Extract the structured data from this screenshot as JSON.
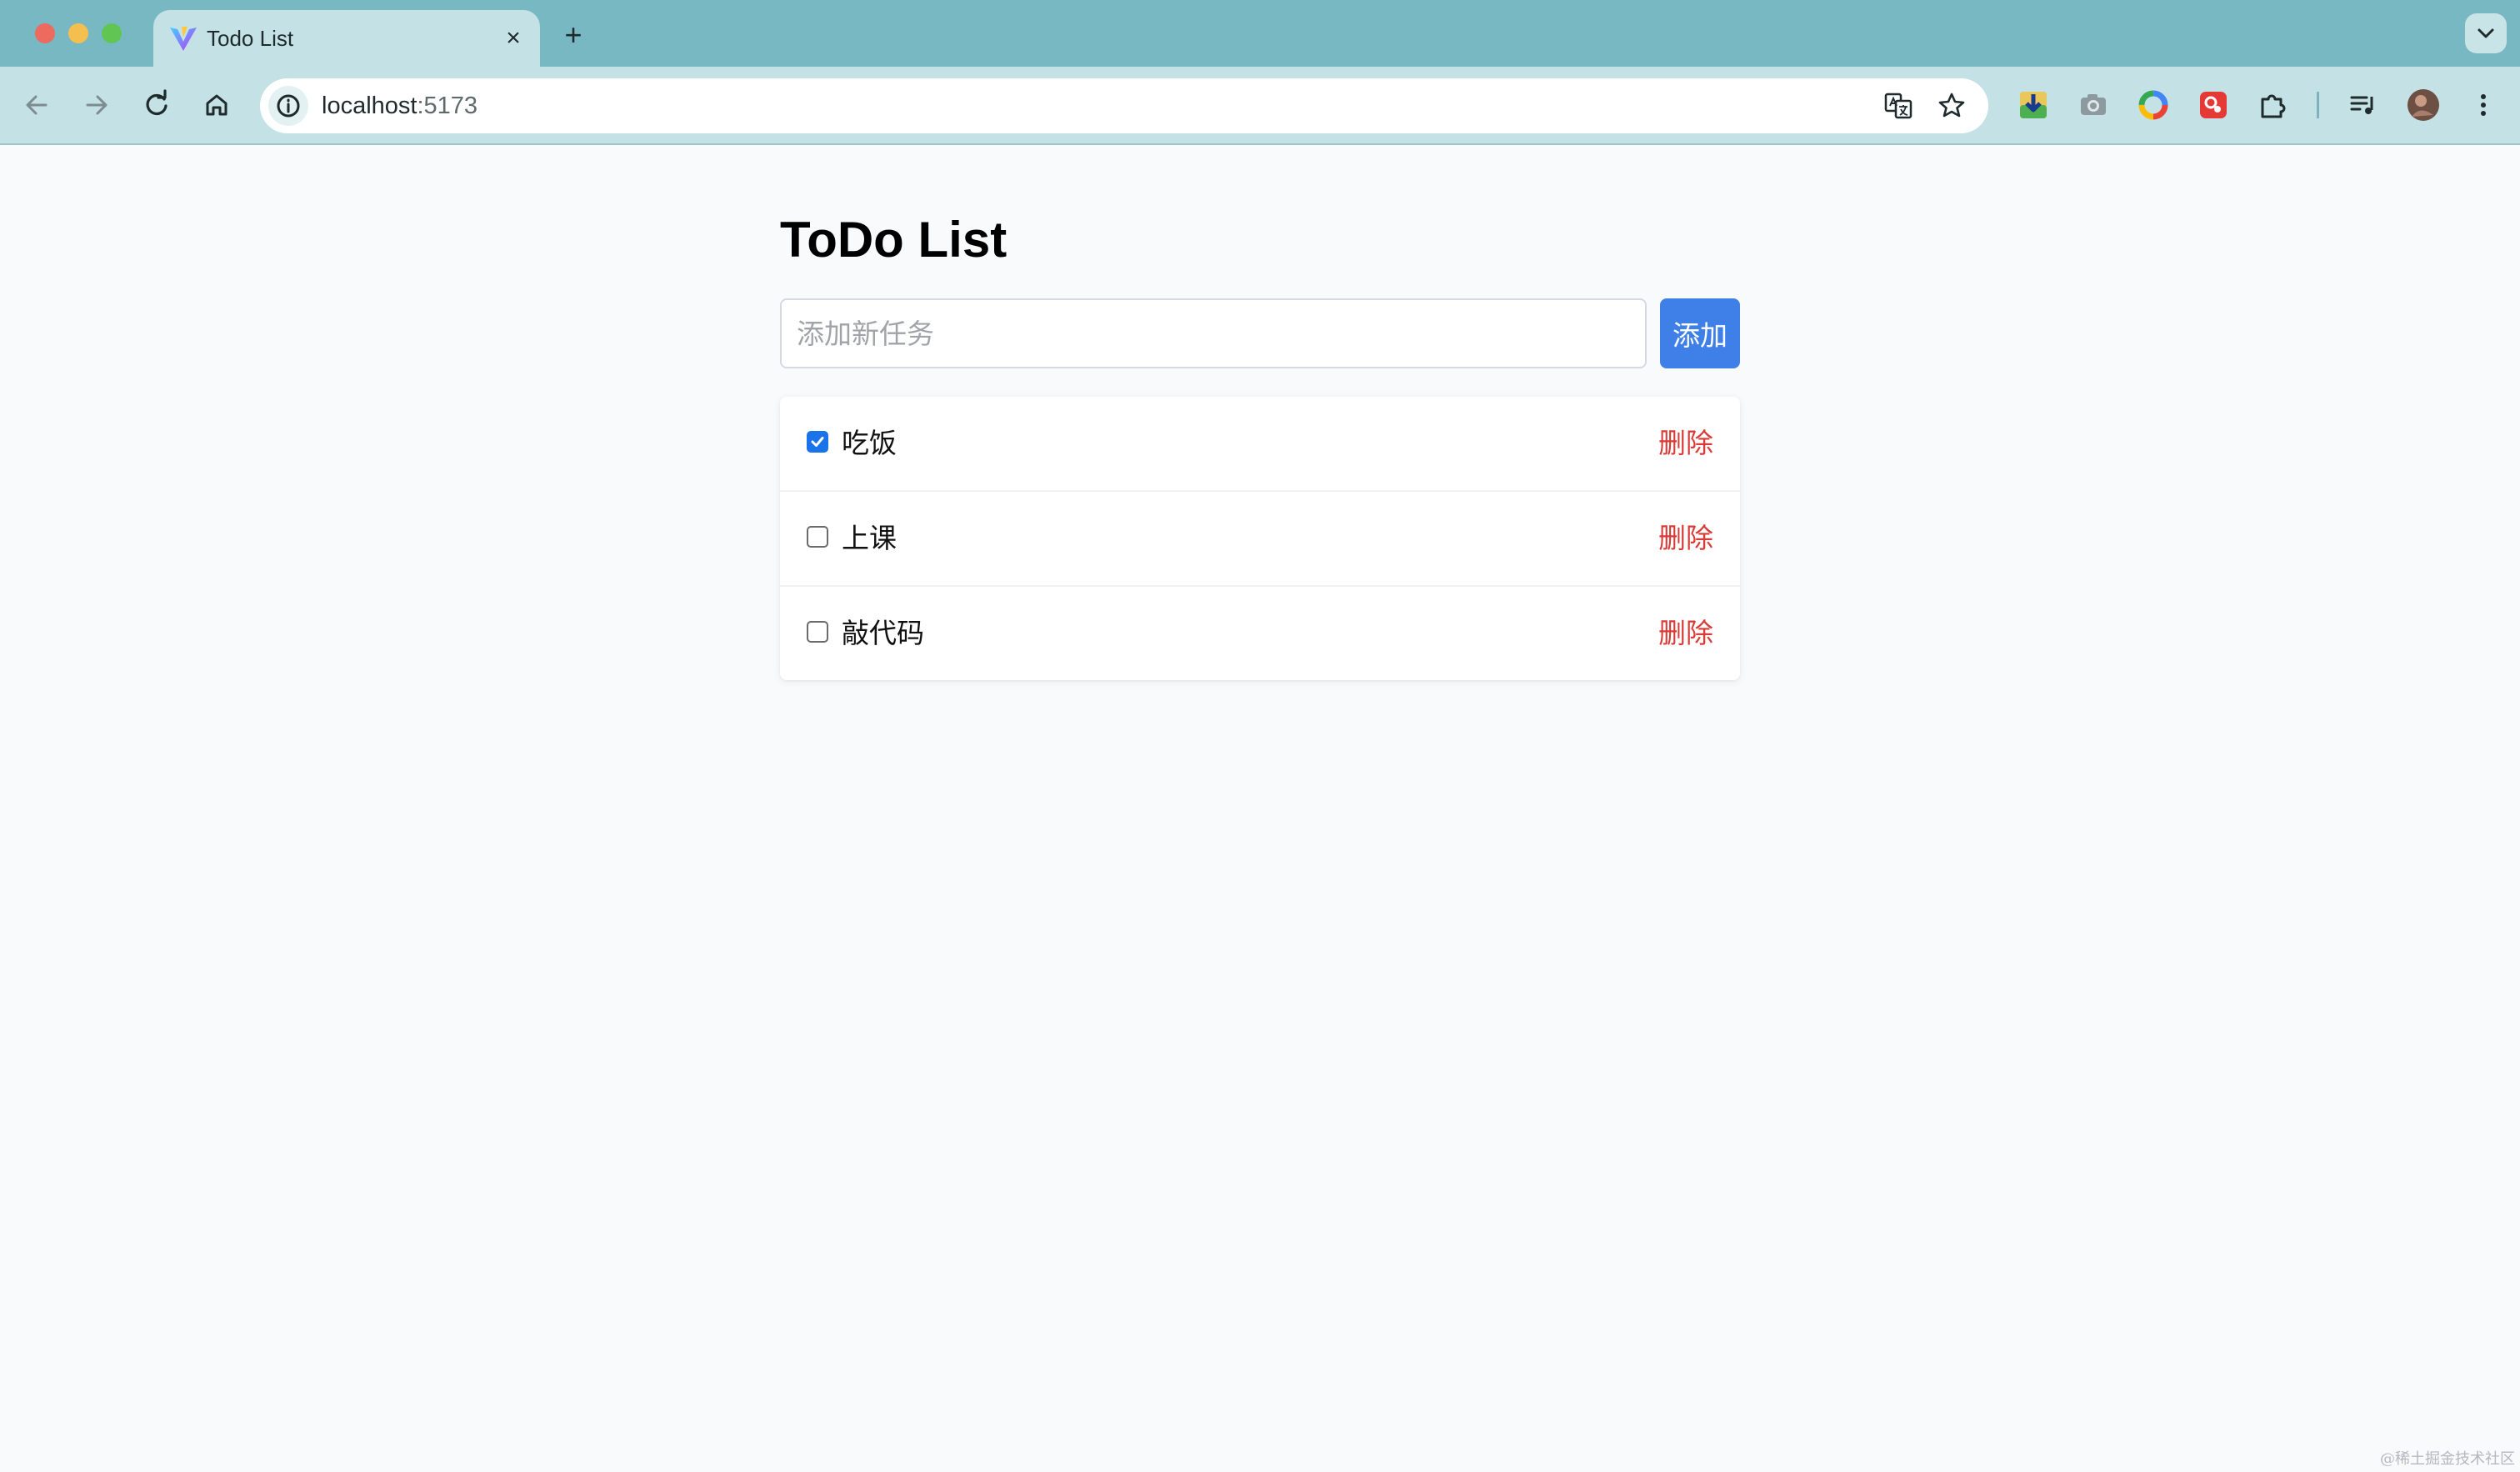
{
  "browser": {
    "tab_title": "Todo List",
    "tab_close": "×",
    "new_tab": "+",
    "url_host": "localhost",
    "url_port": ":5173",
    "icons": [
      "back-icon",
      "forward-icon",
      "reload-icon",
      "home-icon",
      "site-info-icon",
      "translate-icon",
      "bookmark-star-icon",
      "download-extension-icon",
      "camera-extension-icon",
      "colorful-extension-icon",
      "red-extension-icon",
      "extensions-puzzle-icon",
      "media-queue-icon",
      "profile-avatar",
      "more-menu-icon",
      "tab-dropdown-icon"
    ]
  },
  "app": {
    "title": "ToDo List",
    "input_placeholder": "添加新任务",
    "input_value": "",
    "add_label": "添加",
    "delete_label": "删除",
    "todos": [
      {
        "text": "吃饭",
        "done": true
      },
      {
        "text": "上课",
        "done": false
      },
      {
        "text": "敲代码",
        "done": false
      }
    ]
  },
  "watermark": "@稀土掘金技术社区",
  "colors": {
    "accent": "#3f7fe8",
    "delete": "#d93a36",
    "chrome": "#78b8c2",
    "toolbar": "#c4e2e5",
    "background": "#f8fafc"
  }
}
